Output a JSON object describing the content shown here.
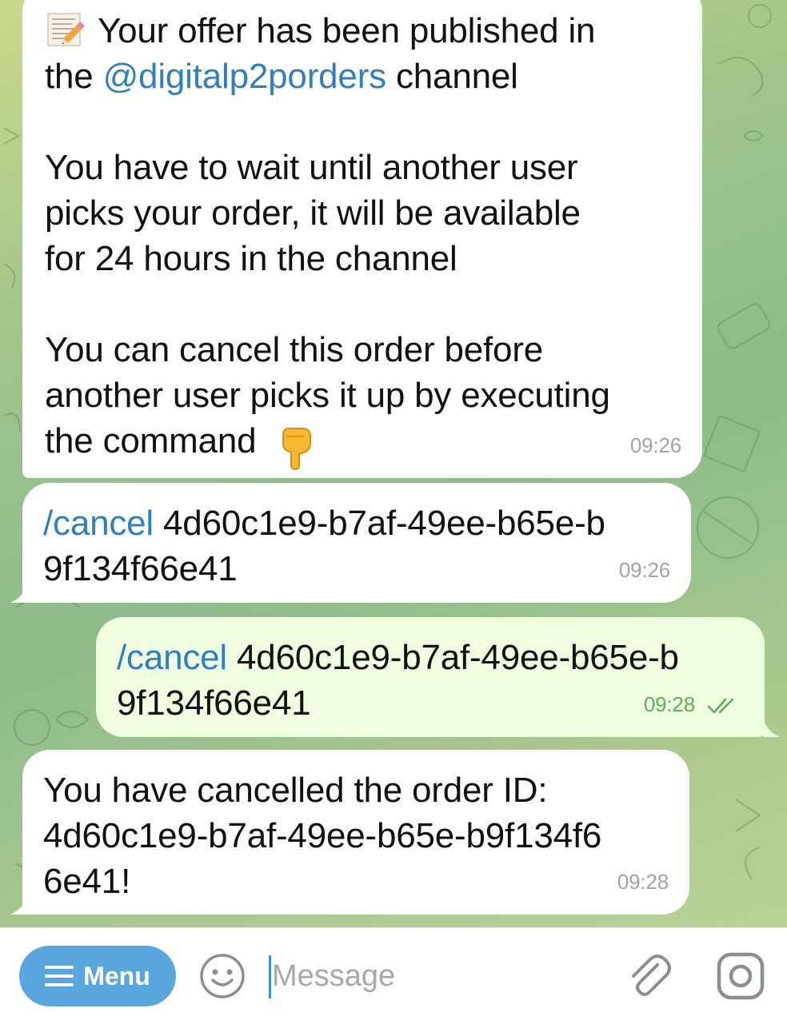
{
  "messages": [
    {
      "id": "publish-notice",
      "direction": "incoming",
      "lead_icon": "memo-icon",
      "line1_text": "Your offer has been published in",
      "line2_prefix": "the ",
      "line2_link": "@digitalp2porders",
      "line2_suffix": " channel",
      "para2": [
        "You have to wait until another user",
        "picks your order, it will be available",
        "for 24 hours in the channel"
      ],
      "para3": [
        "You can cancel this order before",
        "another user picks it up by executing",
        "the command"
      ],
      "trailing_icon": "pointing-down-icon",
      "time": "09:26"
    },
    {
      "id": "cancel-command-suggestion",
      "direction": "incoming",
      "command": "/cancel",
      "line1_rest": " 4d60c1e9-b7af-49ee-b65e-b",
      "line2": "9f134f66e41",
      "time": "09:26"
    },
    {
      "id": "cancel-command-sent",
      "direction": "outgoing",
      "command": "/cancel",
      "line1_rest": " 4d60c1e9-b7af-49ee-b65e-b",
      "line2": "9f134f66e41",
      "time": "09:28",
      "status_icon": "double-check-icon"
    },
    {
      "id": "cancel-confirmation",
      "direction": "incoming",
      "lines": [
        "You have cancelled the order ID:",
        "4d60c1e9-b7af-49ee-b65e-b9f134f6",
        "6e41!"
      ],
      "time": "09:28"
    }
  ],
  "input_bar": {
    "menu_label": "Menu",
    "menu_icon": "hamburger-icon",
    "emoji_icon": "smile-icon",
    "placeholder": "Message",
    "attach_icon": "paperclip-icon",
    "camera_icon": "instagram-camera-icon"
  },
  "colors": {
    "link": "#2f7fc1",
    "incoming_bubble": "#ffffff",
    "outgoing_bubble": "#eefedf",
    "menu_button": "#5aa7e0",
    "outgoing_time": "#5fae5a"
  }
}
